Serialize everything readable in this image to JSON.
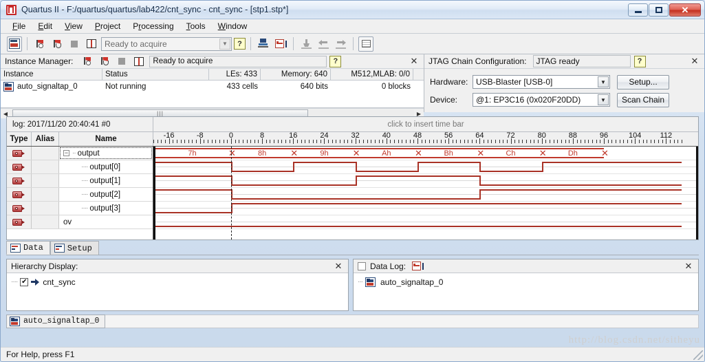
{
  "window": {
    "title": "Quartus II - F:/quartus/quartus/lab422/cnt_sync - cnt_sync - [stp1.stp*]",
    "app_icon": "quartus-icon",
    "minimize": "minimize-button",
    "maximize": "maximize-button",
    "close": "✕"
  },
  "menu": [
    {
      "label": "File"
    },
    {
      "label": "Edit"
    },
    {
      "label": "View"
    },
    {
      "label": "Project"
    },
    {
      "label": "Processing"
    },
    {
      "label": "Tools"
    },
    {
      "label": "Window"
    }
  ],
  "toolbar": {
    "status_combo_value": "Ready to acquire",
    "help_label": "?",
    "buttons": [
      "open-signaltap-icon",
      "run-analysis-icon",
      "autorun-analysis-icon",
      "stop-analysis-icon",
      "read-data-icon",
      "program-device-icon",
      "data-log-icon",
      "insert-node-icon",
      "previous-icon",
      "next-icon",
      "list-view-icon"
    ]
  },
  "instance_manager": {
    "title": "Instance Manager:",
    "status": "Ready to acquire",
    "help_label": "?",
    "close_label": "✕",
    "columns": [
      "Instance",
      "Status",
      "LEs: 433",
      "Memory: 640",
      "M512,MLAB: 0/0"
    ],
    "rows": [
      {
        "instance": "auto_signaltap_0",
        "status": "Not running",
        "les": "433 cells",
        "memory": "640 bits",
        "m512": "0 blocks"
      }
    ],
    "scroll_thumb": "|||"
  },
  "jtag": {
    "title": "JTAG Chain Configuration:",
    "status": "JTAG ready",
    "help_label": "?",
    "close_label": "✕",
    "hardware_label": "Hardware:",
    "hardware_value": "USB-Blaster [USB-0]",
    "setup_button": "Setup...",
    "device_label": "Device:",
    "device_value": "@1: EP3C16 (0x020F20DD)",
    "scan_button": "Scan Chain"
  },
  "waveform": {
    "log_label": "log: 2017/11/20 20:40:41  #0",
    "insert_hint": "click to insert time bar",
    "columns": [
      "Type",
      "Alias",
      "Name"
    ],
    "axis": {
      "ticks": [
        -16,
        -8,
        0,
        8,
        16,
        24,
        32,
        40,
        48,
        56,
        64,
        72,
        80,
        88,
        96,
        104,
        112
      ],
      "min": -20,
      "max": 116,
      "cursor_at": 0
    },
    "signals": [
      {
        "name": "output",
        "alias": "",
        "type_icon": "signal-icon",
        "kind": "bus",
        "expanded": true,
        "selected": true
      },
      {
        "name": "output[0]",
        "alias": "",
        "type_icon": "signal-icon",
        "kind": "bit",
        "child": true,
        "bit": 0
      },
      {
        "name": "output[1]",
        "alias": "",
        "type_icon": "signal-icon",
        "kind": "bit",
        "child": true,
        "bit": 1
      },
      {
        "name": "output[2]",
        "alias": "",
        "type_icon": "signal-icon",
        "kind": "bit",
        "child": true,
        "bit": 2
      },
      {
        "name": "output[3]",
        "alias": "",
        "type_icon": "signal-icon",
        "kind": "bit",
        "child": true,
        "bit": 3
      },
      {
        "name": "ov",
        "alias": "",
        "type_icon": "signal-icon",
        "kind": "bit",
        "child": false,
        "bit": -1
      }
    ],
    "bus_segments": [
      {
        "label": "7h",
        "start": -20,
        "end": 0,
        "value": 7
      },
      {
        "label": "8h",
        "start": 0,
        "end": 16,
        "value": 8
      },
      {
        "label": "9h",
        "start": 16,
        "end": 32,
        "value": 9
      },
      {
        "label": "Ah",
        "start": 32,
        "end": 48,
        "value": 10
      },
      {
        "label": "Bh",
        "start": 48,
        "end": 64,
        "value": 11
      },
      {
        "label": "Ch",
        "start": 64,
        "end": 80,
        "value": 12
      },
      {
        "label": "Dh",
        "start": 80,
        "end": 96,
        "value": 13
      }
    ],
    "ov_value": 0,
    "colors": {
      "wave": "#a93226",
      "bus_text": "#c0392b",
      "grid": "#e3e3e3"
    }
  },
  "tabs": [
    {
      "label": "Data",
      "icon": "data-tab-icon",
      "active": true
    },
    {
      "label": "Setup",
      "icon": "setup-tab-icon",
      "active": false
    }
  ],
  "hierarchy": {
    "title": "Hierarchy Display:",
    "close_label": "✕",
    "items": [
      {
        "label": "cnt_sync",
        "checked": true
      }
    ]
  },
  "data_log": {
    "title": "Data Log:",
    "close_label": "✕",
    "checkbox_checked": false,
    "icon": "data-log-icon",
    "items": [
      {
        "label": "auto_signaltap_0"
      }
    ]
  },
  "instance_tab": {
    "label": "auto_signaltap_0",
    "icon": "signaltap-instance-icon"
  },
  "statusbar": {
    "text": "For Help, press F1"
  },
  "watermark": {
    "text": "http://blog.csdn.net/sitheyu"
  }
}
